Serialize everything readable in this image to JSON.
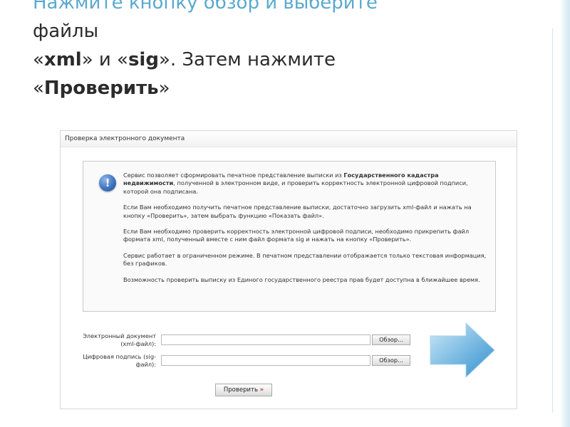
{
  "slide": {
    "line1": "Нажмите кнопку обзор и выберите",
    "line2": "файлы",
    "line3_a": "«",
    "line3_xml": "xml",
    "line3_b": "» и «",
    "line3_sig": "sig",
    "line3_c": "». Затем нажмите",
    "line4_a": "«",
    "line4_btn": "Проверить",
    "line4_b": "»"
  },
  "panel": {
    "title": "Проверка электронного документа",
    "info": {
      "p1_a": "Сервис позволяет сформировать печатное представление выписки из ",
      "p1_bold": "Государственного кадастра недвижимости",
      "p1_b": ", полученной в электронном виде, и проверить корректность электронной цифровой подписи, которой она подписана.",
      "p2": "Если Вам необходимо получить печатное представление выписки, достаточно загрузить xml-файл и нажать на кнопку «Проверить», затем выбрать функцию «Показать файл».",
      "p3": "Если Вам необходимо проверить корректность электронной цифровой подписи, необходимо прикрепить файл формата xml, полученный вместе с ним файл формата sig и нажать на кнопку «Проверить».",
      "p4": "Сервис работает в ограниченном режиме. В печатном представлении отображается только текстовая информация, без графиков.",
      "p5": "Возможность проверить выписку из Единого государственного реестра прав будет доступна в ближайшее время."
    },
    "form": {
      "xml_label_1": "Электронный документ",
      "xml_label_2": "(xml-файл):",
      "sig_label_1": "Цифровая подпись (sig-",
      "sig_label_2": "файл):",
      "browse_label": "Обзор...",
      "check_label": "Проверить",
      "check_arrow": "»"
    }
  },
  "colors": {
    "headline_top": "#5aa9cf",
    "text": "#2b2b2b",
    "arrow_light": "#cde9f7",
    "arrow_dark": "#2f8fd0"
  }
}
